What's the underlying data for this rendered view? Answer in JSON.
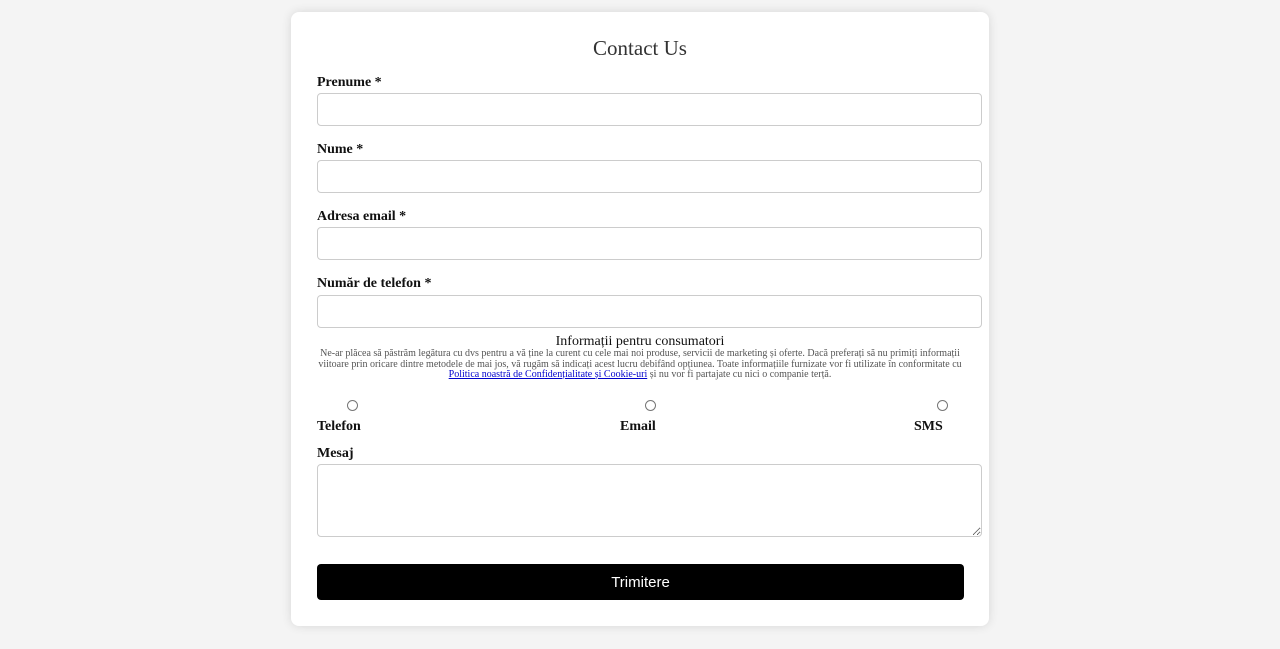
{
  "form": {
    "title": "Contact Us",
    "fields": {
      "first_name": {
        "label": "Prenume *",
        "value": ""
      },
      "last_name": {
        "label": "Nume *",
        "value": ""
      },
      "email": {
        "label": "Adresa email *",
        "value": ""
      },
      "phone": {
        "label": "Număr de telefon *",
        "value": ""
      }
    },
    "consumer_info": {
      "title": "Informații pentru consumatori",
      "text_before_link": "Ne-ar plăcea să păstrăm legătura cu dvs pentru a vă ține la curent cu cele mai noi produse, servicii de marketing și oferte. Dacă preferați să nu primiți informații viitoare prin oricare dintre metodele de mai jos, vă rugăm să indicați acest lucru debifând opțiunea. Toate informațiile furnizate vor fi utilizate în conformitate cu ",
      "link_text": "Politica noastră de Confidențialitate și Cookie-uri",
      "text_after_link": " și nu vor fi partajate cu nici o companie terță."
    },
    "contact_options": [
      {
        "label": "Telefon"
      },
      {
        "label": "Email"
      },
      {
        "label": "SMS"
      }
    ],
    "message": {
      "label": "Mesaj",
      "value": ""
    },
    "submit_label": "Trimitere"
  }
}
